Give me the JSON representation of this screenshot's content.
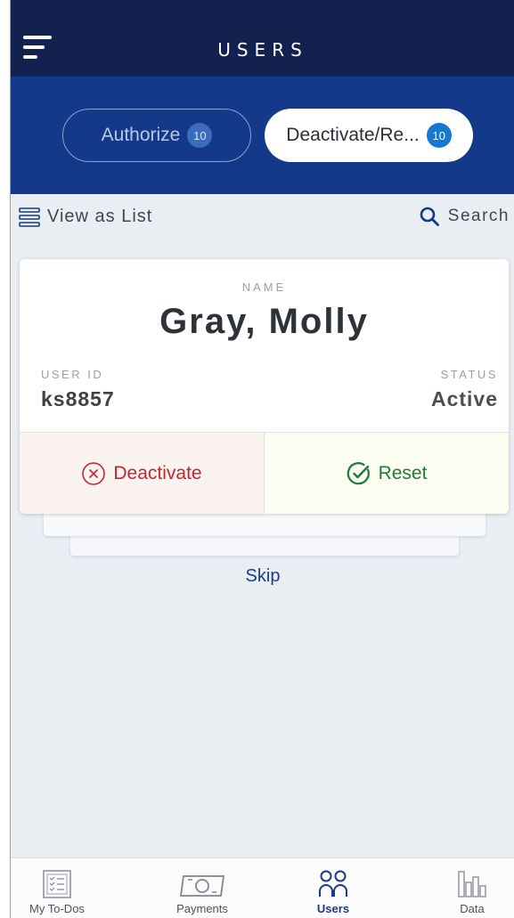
{
  "header": {
    "title": "USERS"
  },
  "tabs": [
    {
      "label": "Authorize",
      "count": "10",
      "selected": false
    },
    {
      "label": "Deactivate/Re...",
      "count": "10",
      "selected": true
    }
  ],
  "toolbar": {
    "view_as_list": "View as List",
    "search": "Search"
  },
  "user": {
    "name_label": "NAME",
    "name": "Gray, Molly",
    "user_id_label": "USER ID",
    "user_id": "ks8857",
    "status_label": "STATUS",
    "status": "Active"
  },
  "actions": {
    "deactivate": "Deactivate",
    "reset": "Reset"
  },
  "skip_label": "Skip",
  "bottom_nav": [
    {
      "label": "My To-Dos",
      "icon": "checklist-icon"
    },
    {
      "label": "Payments",
      "icon": "money-icon"
    },
    {
      "label": "Users",
      "icon": "users-icon",
      "active": true
    },
    {
      "label": "Data",
      "icon": "bar-chart-icon"
    }
  ],
  "colors": {
    "header": "#13214f",
    "tab_bar": "#15398a",
    "deactivate": "#c3262c",
    "reset": "#1f7a3b",
    "accent": "#1b3a86"
  }
}
